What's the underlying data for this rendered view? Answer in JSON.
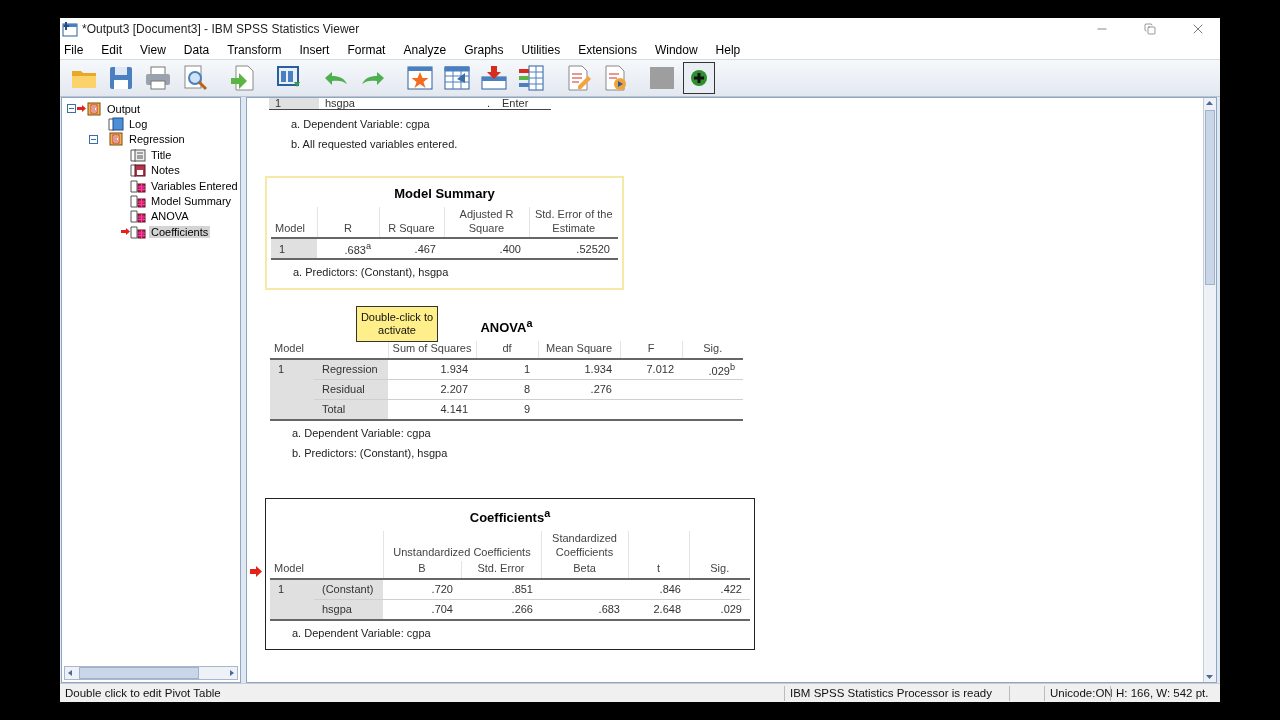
{
  "window": {
    "title": "*Output3 [Document3] - IBM SPSS Statistics Viewer"
  },
  "menu": [
    "File",
    "Edit",
    "View",
    "Data",
    "Transform",
    "Insert",
    "Format",
    "Analyze",
    "Graphs",
    "Utilities",
    "Extensions",
    "Window",
    "Help"
  ],
  "outline": [
    {
      "label": "Output",
      "kind": "output",
      "expanded": true,
      "current": true,
      "selected": false,
      "children": [
        {
          "label": "Log",
          "kind": "log",
          "current": false,
          "selected": false
        },
        {
          "label": "Regression",
          "kind": "output",
          "expanded": true,
          "current": false,
          "selected": false,
          "children": [
            {
              "label": "Title",
              "kind": "title",
              "current": false,
              "selected": false
            },
            {
              "label": "Notes",
              "kind": "notes",
              "current": false,
              "selected": false
            },
            {
              "label": "Variables Entered",
              "kind": "table",
              "current": false,
              "selected": false
            },
            {
              "label": "Model Summary",
              "kind": "table",
              "current": false,
              "selected": false
            },
            {
              "label": "ANOVA",
              "kind": "table",
              "current": false,
              "selected": false
            },
            {
              "label": "Coefficients",
              "kind": "table",
              "current": true,
              "selected": true
            }
          ]
        }
      ]
    }
  ],
  "partial_table": {
    "row": [
      "1",
      "hsgpa",
      ".",
      "Enter"
    ],
    "notes": [
      "a. Dependent Variable: cgpa",
      "b. All requested variables entered."
    ]
  },
  "tables": [
    {
      "title": "Model Summary",
      "highlighted": true,
      "selected": false,
      "current": false,
      "header_rows": [
        [
          {
            "label": "Model"
          },
          {
            "label": "R"
          },
          {
            "label": "R Square"
          },
          {
            "label": "Adjusted R Square"
          },
          {
            "label": "Std. Error of the Estimate"
          }
        ]
      ],
      "rows": [
        {
          "cells": [
            "1",
            ".683$^{a}$",
            ".467",
            ".400",
            ".52520"
          ]
        }
      ],
      "notes": [
        "a. Predictors: (Constant), hsgpa"
      ]
    },
    {
      "title": "ANOVA$^{a}$",
      "highlighted": false,
      "selected": false,
      "current": false,
      "tooltip": "Double-click to activate",
      "header_rows": [
        [
          {
            "label": "Model",
            "colspan": 2
          },
          {
            "label": "Sum of Squares"
          },
          {
            "label": "df"
          },
          {
            "label": "Mean Square"
          },
          {
            "label": "F"
          },
          {
            "label": "Sig."
          }
        ]
      ],
      "rows": [
        {
          "cells": [
            "1",
            "Regression",
            "1.934",
            "1",
            "1.934",
            "7.012",
            ".029$^{b}$"
          ]
        },
        {
          "cells": [
            null,
            "Residual",
            "2.207",
            "8",
            ".276",
            null,
            null
          ]
        },
        {
          "cells": [
            null,
            "Total",
            "4.141",
            "9",
            null,
            null,
            null
          ]
        }
      ],
      "notes": [
        "a. Dependent Variable: cgpa",
        "b. Predictors: (Constant), hsgpa"
      ]
    },
    {
      "title": "Coefficients$^{a}$",
      "highlighted": false,
      "selected": true,
      "current": true,
      "header_rows": [
        [
          {
            "label": "Model",
            "colspan": 2,
            "rowspan": 2
          },
          {
            "label": "Unstandardized Coefficients",
            "colspan": 2
          },
          {
            "label": "Standardized Coefficients"
          },
          {
            "label": "t",
            "rowspan": 2
          },
          {
            "label": "Sig.",
            "rowspan": 2
          }
        ],
        [
          {
            "label": "B"
          },
          {
            "label": "Std. Error"
          },
          {
            "label": "Beta"
          }
        ]
      ],
      "rows": [
        {
          "cells": [
            "1",
            "(Constant)",
            ".720",
            ".851",
            null,
            ".846",
            ".422"
          ]
        },
        {
          "cells": [
            null,
            "hsgpa",
            ".704",
            ".266",
            ".683",
            "2.648",
            ".029"
          ]
        }
      ],
      "notes": [
        "a. Dependent Variable: cgpa"
      ]
    }
  ],
  "status_bar": {
    "message": "Double click to edit Pivot Table",
    "processor": "IBM SPSS Statistics Processor is ready",
    "unicode": "Unicode:ON",
    "size": "H: 166, W: 542 pt."
  }
}
